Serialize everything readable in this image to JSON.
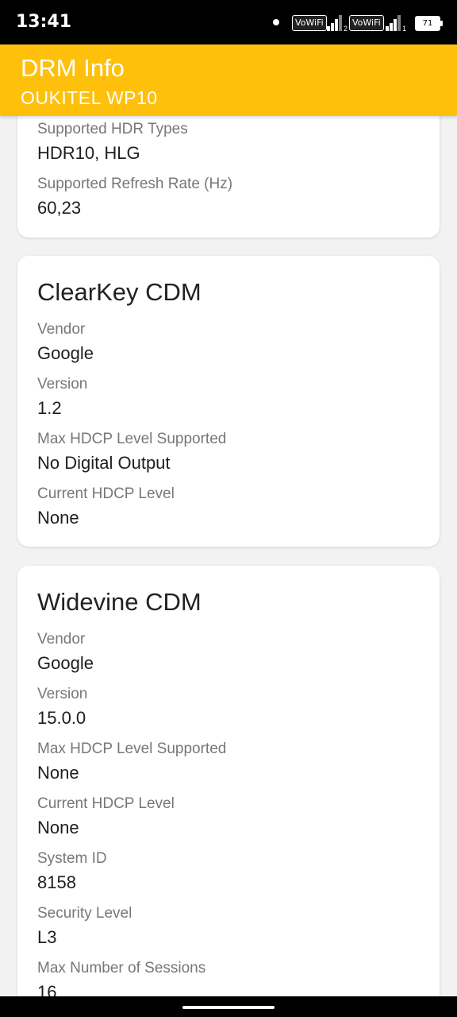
{
  "status_bar": {
    "time": "13:41",
    "vowifi_1": "VoWiFi",
    "vowifi_2": "VoWiFi",
    "signal_1_sub": "2",
    "signal_2_sub": "1",
    "battery": "71"
  },
  "app_bar": {
    "title": "DRM Info",
    "subtitle": "OUKITEL WP10",
    "background": "#fec00b"
  },
  "display_card": {
    "rows": [
      {
        "label": "Supported HDR Types",
        "value": "HDR10, HLG"
      },
      {
        "label": "Supported Refresh Rate (Hz)",
        "value": "60,23"
      }
    ]
  },
  "clearkey_card": {
    "title": "ClearKey CDM",
    "rows": [
      {
        "label": "Vendor",
        "value": "Google"
      },
      {
        "label": "Version",
        "value": "1.2"
      },
      {
        "label": "Max HDCP Level Supported",
        "value": "No Digital Output"
      },
      {
        "label": "Current HDCP Level",
        "value": "None"
      }
    ]
  },
  "widevine_card": {
    "title": "Widevine CDM",
    "rows": [
      {
        "label": "Vendor",
        "value": "Google"
      },
      {
        "label": "Version",
        "value": "15.0.0"
      },
      {
        "label": "Max HDCP Level Supported",
        "value": "None"
      },
      {
        "label": "Current HDCP Level",
        "value": "None"
      },
      {
        "label": "System ID",
        "value": "8158"
      },
      {
        "label": "Security Level",
        "value": "L3"
      },
      {
        "label": "Max Number of Sessions",
        "value": "16"
      }
    ]
  }
}
